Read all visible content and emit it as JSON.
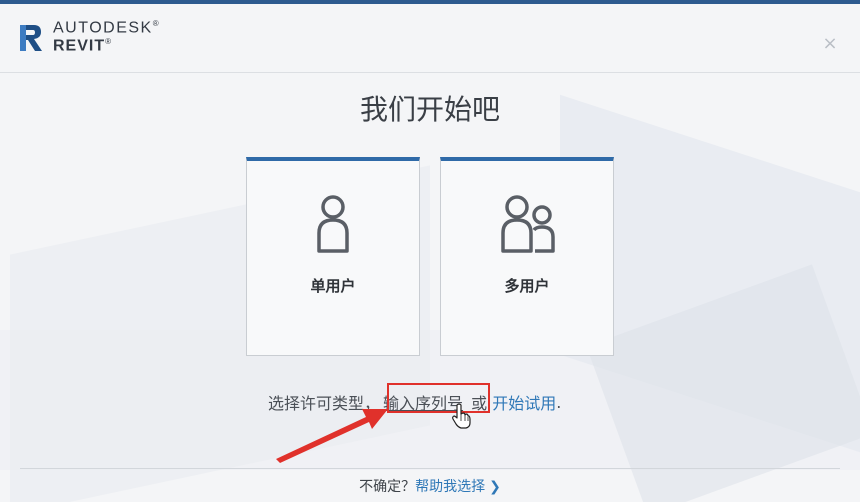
{
  "brand": {
    "company": "AUTODESK",
    "product": "REVIT",
    "reg_mark": "®"
  },
  "window": {
    "close_glyph": "×"
  },
  "title": "我们开始吧",
  "cards": [
    {
      "label": "单用户",
      "icon": "single-user-icon"
    },
    {
      "label": "多用户",
      "icon": "multi-user-icon"
    }
  ],
  "license": {
    "prompt": "选择许可类型，",
    "serial_link": "输入序列号",
    "or": "或",
    "trial_link": "开始试用",
    "period": "."
  },
  "footer": {
    "question": "不确定？",
    "help_link": "帮助我选择",
    "chevron": "❯"
  },
  "colors": {
    "accent_blue": "#2f6aa8",
    "link_blue": "#2f78b7",
    "highlight_red": "#e0312b"
  }
}
